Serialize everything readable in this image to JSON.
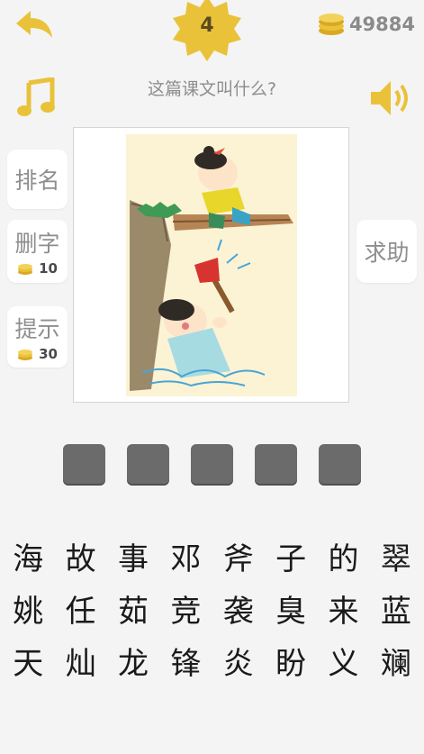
{
  "level": "4",
  "coins": "49884",
  "question": "这篇课文叫什么?",
  "side_buttons": {
    "rank": "排名",
    "delete": "删字",
    "delete_cost": "10",
    "hint": "提示",
    "hint_cost": "30",
    "help": "求助"
  },
  "answer_slots": 5,
  "characters": [
    [
      "海",
      "故",
      "事",
      "邓",
      "斧",
      "子",
      "的",
      "翠"
    ],
    [
      "姚",
      "任",
      "茹",
      "竞",
      "袭",
      "臭",
      "来",
      "蓝"
    ],
    [
      "天",
      "灿",
      "龙",
      "锋",
      "炎",
      "盼",
      "义",
      "斓"
    ]
  ],
  "colors": {
    "accent_gold": "#e9c23a",
    "slot": "#6b6b6b",
    "background": "#f4f4f4"
  },
  "icons": {
    "back": "back-arrow-icon",
    "music": "music-note-icon",
    "sound": "speaker-icon",
    "coin": "coin-stack-icon",
    "level": "star-badge-icon"
  }
}
